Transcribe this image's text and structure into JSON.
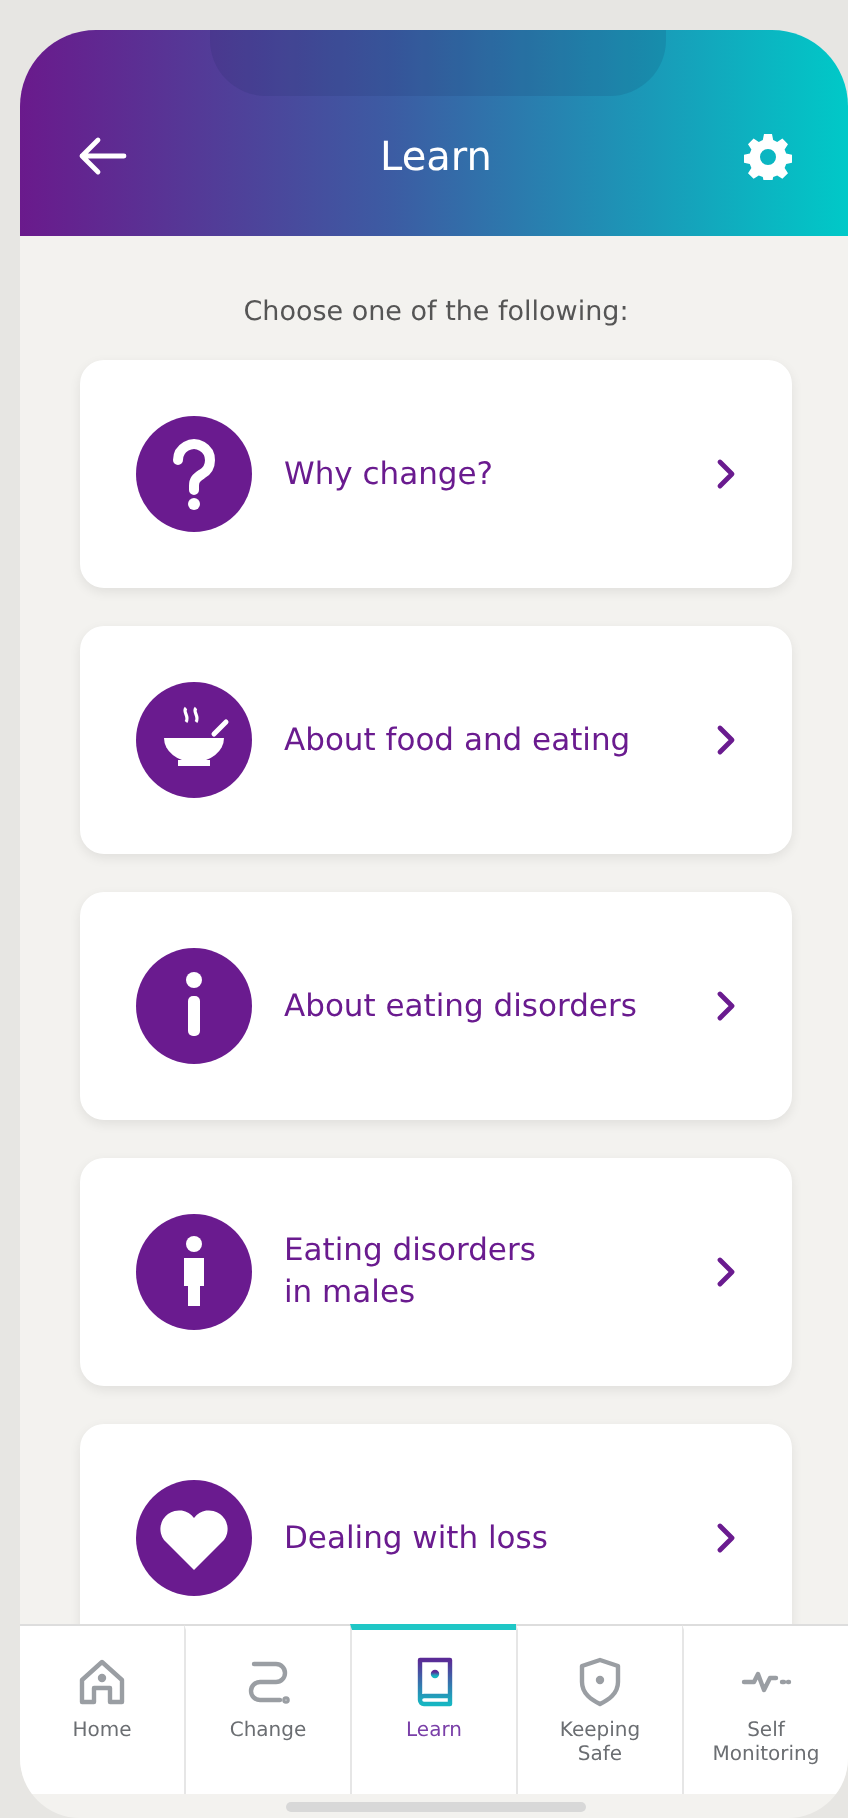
{
  "header": {
    "title": "Learn"
  },
  "subtitle": "Choose one of the following:",
  "items": [
    {
      "label": "Why change?",
      "kind": "question"
    },
    {
      "label": "About food and eating",
      "kind": "bowl"
    },
    {
      "label": "About eating disorders",
      "kind": "info"
    },
    {
      "label": "Eating disorders\nin males",
      "kind": "person"
    },
    {
      "label": "Dealing with loss",
      "kind": "heart"
    }
  ],
  "tabs": [
    {
      "label": "Home",
      "kind": "home",
      "selected": false
    },
    {
      "label": "Change",
      "kind": "change",
      "selected": false
    },
    {
      "label": "Learn",
      "kind": "book",
      "selected": true
    },
    {
      "label": "Keeping\nSafe",
      "kind": "shield",
      "selected": false
    },
    {
      "label": "Self\nMonitoring",
      "kind": "pulse",
      "selected": false
    }
  ]
}
